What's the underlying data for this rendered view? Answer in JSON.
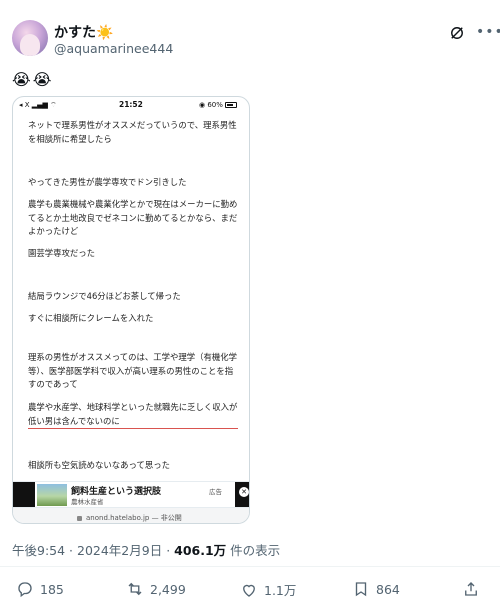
{
  "user": {
    "display_name": "かすた☀️",
    "handle": "@aquamarinee444"
  },
  "tweet": {
    "text": "😭😭"
  },
  "screenshot": {
    "status_bar": {
      "left": "◂ X ▂▄▆ ⌔",
      "time": "21:52",
      "battery": "◉ 60%"
    },
    "paragraphs": [
      "ネットで理系男性がオススメだっていうので、理系男性を相談所に希望したら",
      "やってきた男性が農学専攻でドン引きした",
      "農学も農業機械や農業化学とかで現在はメーカーに勤めてるとか土地改良でゼネコンに勤めてるとかなら、まだよかったけど",
      "園芸学専攻だった",
      "結局ラウンジで46分ほどお茶して帰った",
      "すぐに相談所にクレームを入れた",
      "理系の男性がオススメってのは、工学や理学（有機化学等）、医学部医学科で収入が高い理系の男性のことを指すのであって",
      "農学や水産学、地球科学といった就職先に乏しく収入が低い男は含んでないのに",
      "相談所も空気読めないなあって思った"
    ],
    "ad": {
      "title": "飼料生産という選択肢",
      "sponsor": "農林水産省",
      "label": "広告",
      "close": "✕"
    },
    "url": "anond.hatelabo.jp — 非公開"
  },
  "meta": {
    "time": "午後9:54",
    "date": "2024年2月9日",
    "views_count": "406.1万",
    "views_label": "件の表示"
  },
  "actions": {
    "replies": "185",
    "reposts": "2,499",
    "likes": "1.1万",
    "bookmarks": "864"
  }
}
